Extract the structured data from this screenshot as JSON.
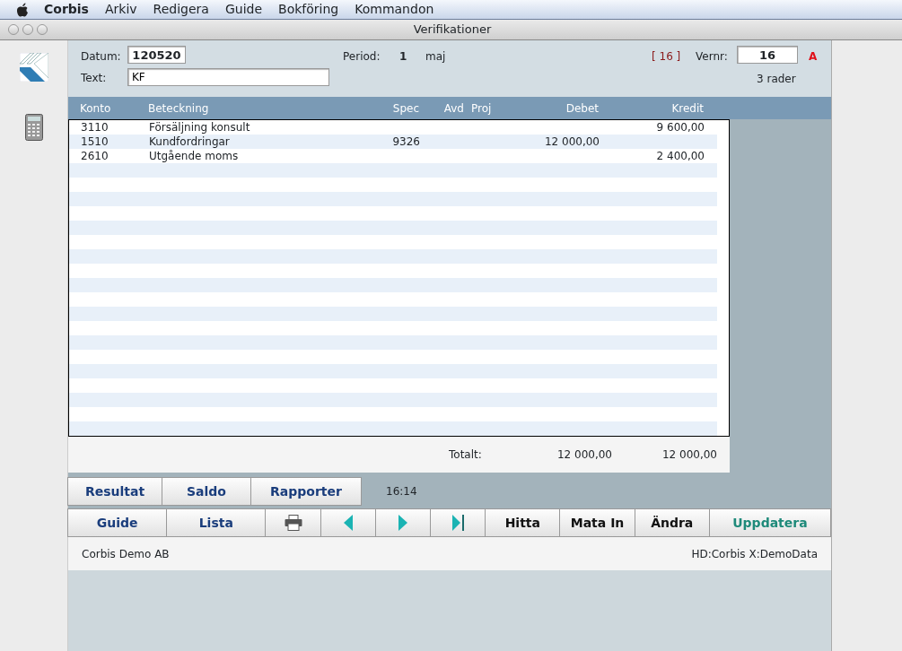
{
  "menubar": {
    "app": "Corbis",
    "items": [
      "Arkiv",
      "Redigera",
      "Guide",
      "Bokföring",
      "Kommandon"
    ]
  },
  "window": {
    "title": "Verifikationer"
  },
  "form": {
    "datum_label": "Datum:",
    "datum": "120520",
    "period_label": "Period:",
    "period": "1",
    "month": "maj",
    "bracket": "[ 16 ]",
    "vernr_label": "Vernr:",
    "vernr": "16",
    "series": "A",
    "text_label": "Text:",
    "text": "KF",
    "row_count": "3 rader"
  },
  "table": {
    "columns": [
      "Konto",
      "Beteckning",
      "Spec",
      "Avd",
      "Proj",
      "Debet",
      "Kredit"
    ],
    "rows": [
      [
        "3110",
        "Försäljning konsult",
        "",
        "",
        "",
        "",
        "9 600,00"
      ],
      [
        "1510",
        "Kundfordringar",
        "9326",
        "",
        "",
        "12 000,00",
        ""
      ],
      [
        "2610",
        "Utgående moms",
        "",
        "",
        "",
        "",
        "2 400,00"
      ]
    ],
    "total_label": "Totalt:",
    "total_debet": "12 000,00",
    "total_kredit": "12 000,00"
  },
  "report_buttons": [
    "Resultat",
    "Saldo",
    "Rapporter"
  ],
  "time": "16:14",
  "toolbar": [
    {
      "kind": "nav",
      "label": "Guide"
    },
    {
      "kind": "nav",
      "label": "Lista"
    },
    {
      "kind": "print"
    },
    {
      "kind": "prev"
    },
    {
      "kind": "next"
    },
    {
      "kind": "last"
    },
    {
      "kind": "action",
      "label": "Hitta"
    },
    {
      "kind": "action",
      "label": "Mata In"
    },
    {
      "kind": "action",
      "label": "Ändra"
    },
    {
      "kind": "update",
      "label": "Uppdatera"
    }
  ],
  "status_bar": {
    "company": "Corbis Demo AB",
    "path": "HD:Corbis X:DemoData"
  }
}
